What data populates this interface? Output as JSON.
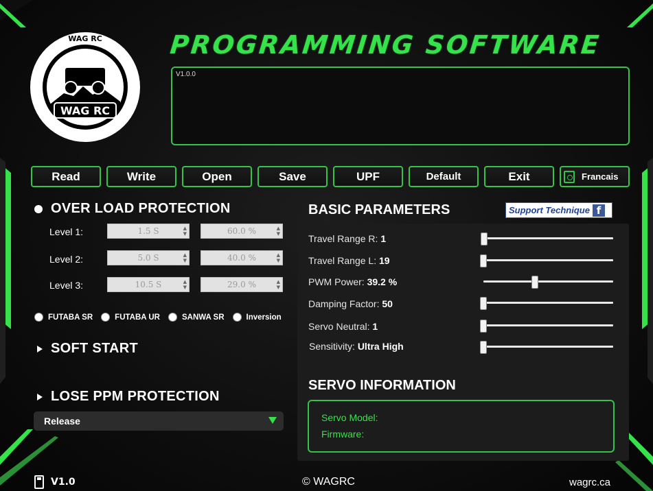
{
  "app": {
    "title": "PROGRAMMING SOFTWARE",
    "log_text": "V1.0.0",
    "accent_color": "#35e24a",
    "logo": {
      "ring_text": "WAG RC",
      "badge_text": "WAG RC"
    }
  },
  "toolbar": {
    "read": "Read",
    "write": "Write",
    "open": "Open",
    "save": "Save",
    "upf": "UPF",
    "default": "Default",
    "exit": "Exit",
    "language": "Francais"
  },
  "overload": {
    "heading": "OVER LOAD PROTECTION",
    "levels": [
      {
        "label": "Level 1:",
        "time": "1.5 S",
        "percent": "60.0 %"
      },
      {
        "label": "Level 2:",
        "time": "5.0 S",
        "percent": "40.0 %"
      },
      {
        "label": "Level 3:",
        "time": "10.5 S",
        "percent": "29.0 %"
      }
    ]
  },
  "protocols": {
    "options": [
      "FUTABA SR",
      "FUTABA UR",
      "SANWA SR",
      "Inversion"
    ]
  },
  "soft_start": {
    "heading": "SOFT START"
  },
  "lose_ppm": {
    "heading": "LOSE PPM PROTECTION",
    "selected": "Release"
  },
  "basic": {
    "heading": "BASIC PARAMETERS",
    "support_label": "Support Technique",
    "support_icon": "facebook-icon",
    "params": [
      {
        "label": "Travel Range R:",
        "value": "1",
        "level": 0.0
      },
      {
        "label": "Travel Range L:",
        "value": "19",
        "level": 0.0
      },
      {
        "label": "PWM Power:",
        "value": "39.2 %",
        "level": 0.392
      },
      {
        "label": "Damping Factor:",
        "value": "50",
        "level": 0.0
      },
      {
        "label": "Servo Neutral:",
        "value": "1",
        "level": 0.0
      },
      {
        "label": "Sensitivity:",
        "value": "Ultra High",
        "level": 0.0
      }
    ]
  },
  "servo_info": {
    "heading": "SERVO INFORMATION",
    "model_label": "Servo Model:",
    "firmware_label": "Firmware:"
  },
  "footer": {
    "version": "V1.0",
    "copyright": "© WAGRC",
    "url": "wagrc.ca"
  }
}
